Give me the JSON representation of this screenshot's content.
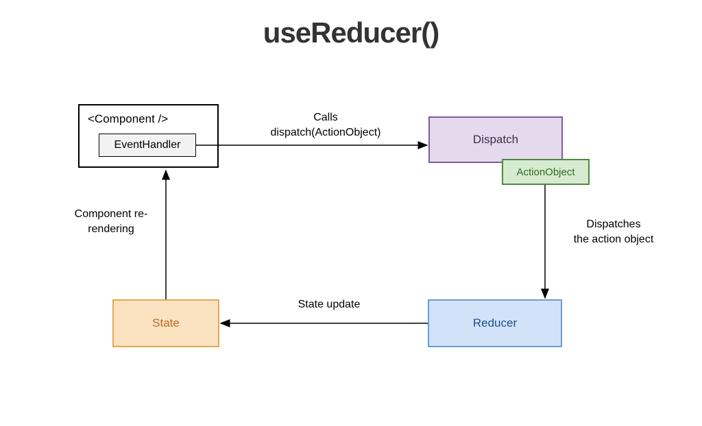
{
  "title": "useReducer()",
  "nodes": {
    "component": {
      "label": "<Component />"
    },
    "event_handler": {
      "label": "EventHandler"
    },
    "dispatch": {
      "label": "Dispatch"
    },
    "action_object": {
      "label": "ActionObject"
    },
    "reducer": {
      "label": "Reducer"
    },
    "state": {
      "label": "State"
    }
  },
  "edges": {
    "calls_dispatch": {
      "line1": "Calls",
      "line2": "dispatch(ActionObject)"
    },
    "dispatches_action": {
      "line1": "Dispatches",
      "line2": "the action object"
    },
    "state_update": {
      "label": "State update"
    },
    "rerender": {
      "line1": "Component re-",
      "line2": "rendering"
    }
  },
  "chart_data": {
    "type": "flow-diagram",
    "title": "useReducer()",
    "nodes": [
      {
        "id": "component",
        "label": "<Component />",
        "contains": [
          "event_handler"
        ]
      },
      {
        "id": "event_handler",
        "label": "EventHandler"
      },
      {
        "id": "dispatch",
        "label": "Dispatch",
        "attached": [
          "action_object"
        ]
      },
      {
        "id": "action_object",
        "label": "ActionObject"
      },
      {
        "id": "reducer",
        "label": "Reducer"
      },
      {
        "id": "state",
        "label": "State"
      }
    ],
    "edges": [
      {
        "from": "event_handler",
        "to": "dispatch",
        "label": "Calls dispatch(ActionObject)"
      },
      {
        "from": "dispatch",
        "to": "reducer",
        "label": "Dispatches the action object"
      },
      {
        "from": "reducer",
        "to": "state",
        "label": "State update"
      },
      {
        "from": "state",
        "to": "component",
        "label": "Component re-rendering"
      }
    ]
  }
}
